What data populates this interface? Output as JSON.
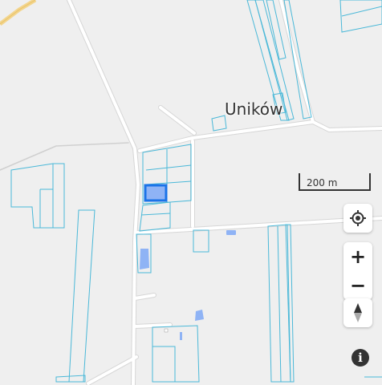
{
  "map": {
    "place_name": "Uników",
    "scale_label": "200 m",
    "colors": {
      "background": "#efefef",
      "road": "#ffffff",
      "road_edge": "#d4d4d4",
      "parcel_outline": "#4ab8d8",
      "selected_parcel": "#1a73e8",
      "water": "#8fb3f5",
      "major_road": "#f3d58c"
    }
  },
  "controls": {
    "locate_icon": "crosshair-icon",
    "zoom_in_label": "+",
    "zoom_out_label": "−",
    "compass_icon": "compass-icon",
    "info_label": "i"
  }
}
